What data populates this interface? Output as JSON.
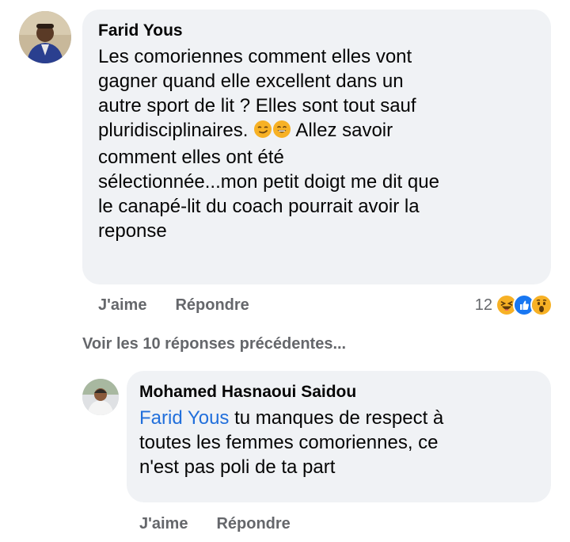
{
  "comment": {
    "author": "Farid Yous",
    "text_before_emoji": "Les comoriennes comment elles vont\ngagner quand elle excellent dans un\nautre sport de lit ? Elles sont tout sauf\npluridisciplinaires. ",
    "emojis": [
      "smirking-face-icon",
      "grinning-face-icon"
    ],
    "text_after_emoji": " Allez savoir\ncomment elles ont été\nsélectionnée...mon petit doigt me dit que\nle canapé-lit du coach pourrait avoir la\nreponse",
    "like_label": "J'aime",
    "reply_label": "Répondre",
    "reaction_count": "12",
    "reaction_icons": [
      "haha-icon",
      "like-icon",
      "wow-icon"
    ]
  },
  "view_previous_replies": "Voir les 10 réponses précédentes...",
  "reply": {
    "author": "Mohamed Hasnaoui Saidou",
    "mention": "Farid Yous",
    "text": " tu manques de respect à\ntoutes les femmes comoriennes, ce\nn'est pas poli de ta part",
    "like_label": "J'aime",
    "reply_label": "Répondre"
  },
  "colors": {
    "bubble": "#f0f2f5",
    "mention": "#216fdb",
    "secondary_text": "#65676b",
    "like_blue": "#1877f2",
    "reaction_yellow": "#f7b125"
  }
}
